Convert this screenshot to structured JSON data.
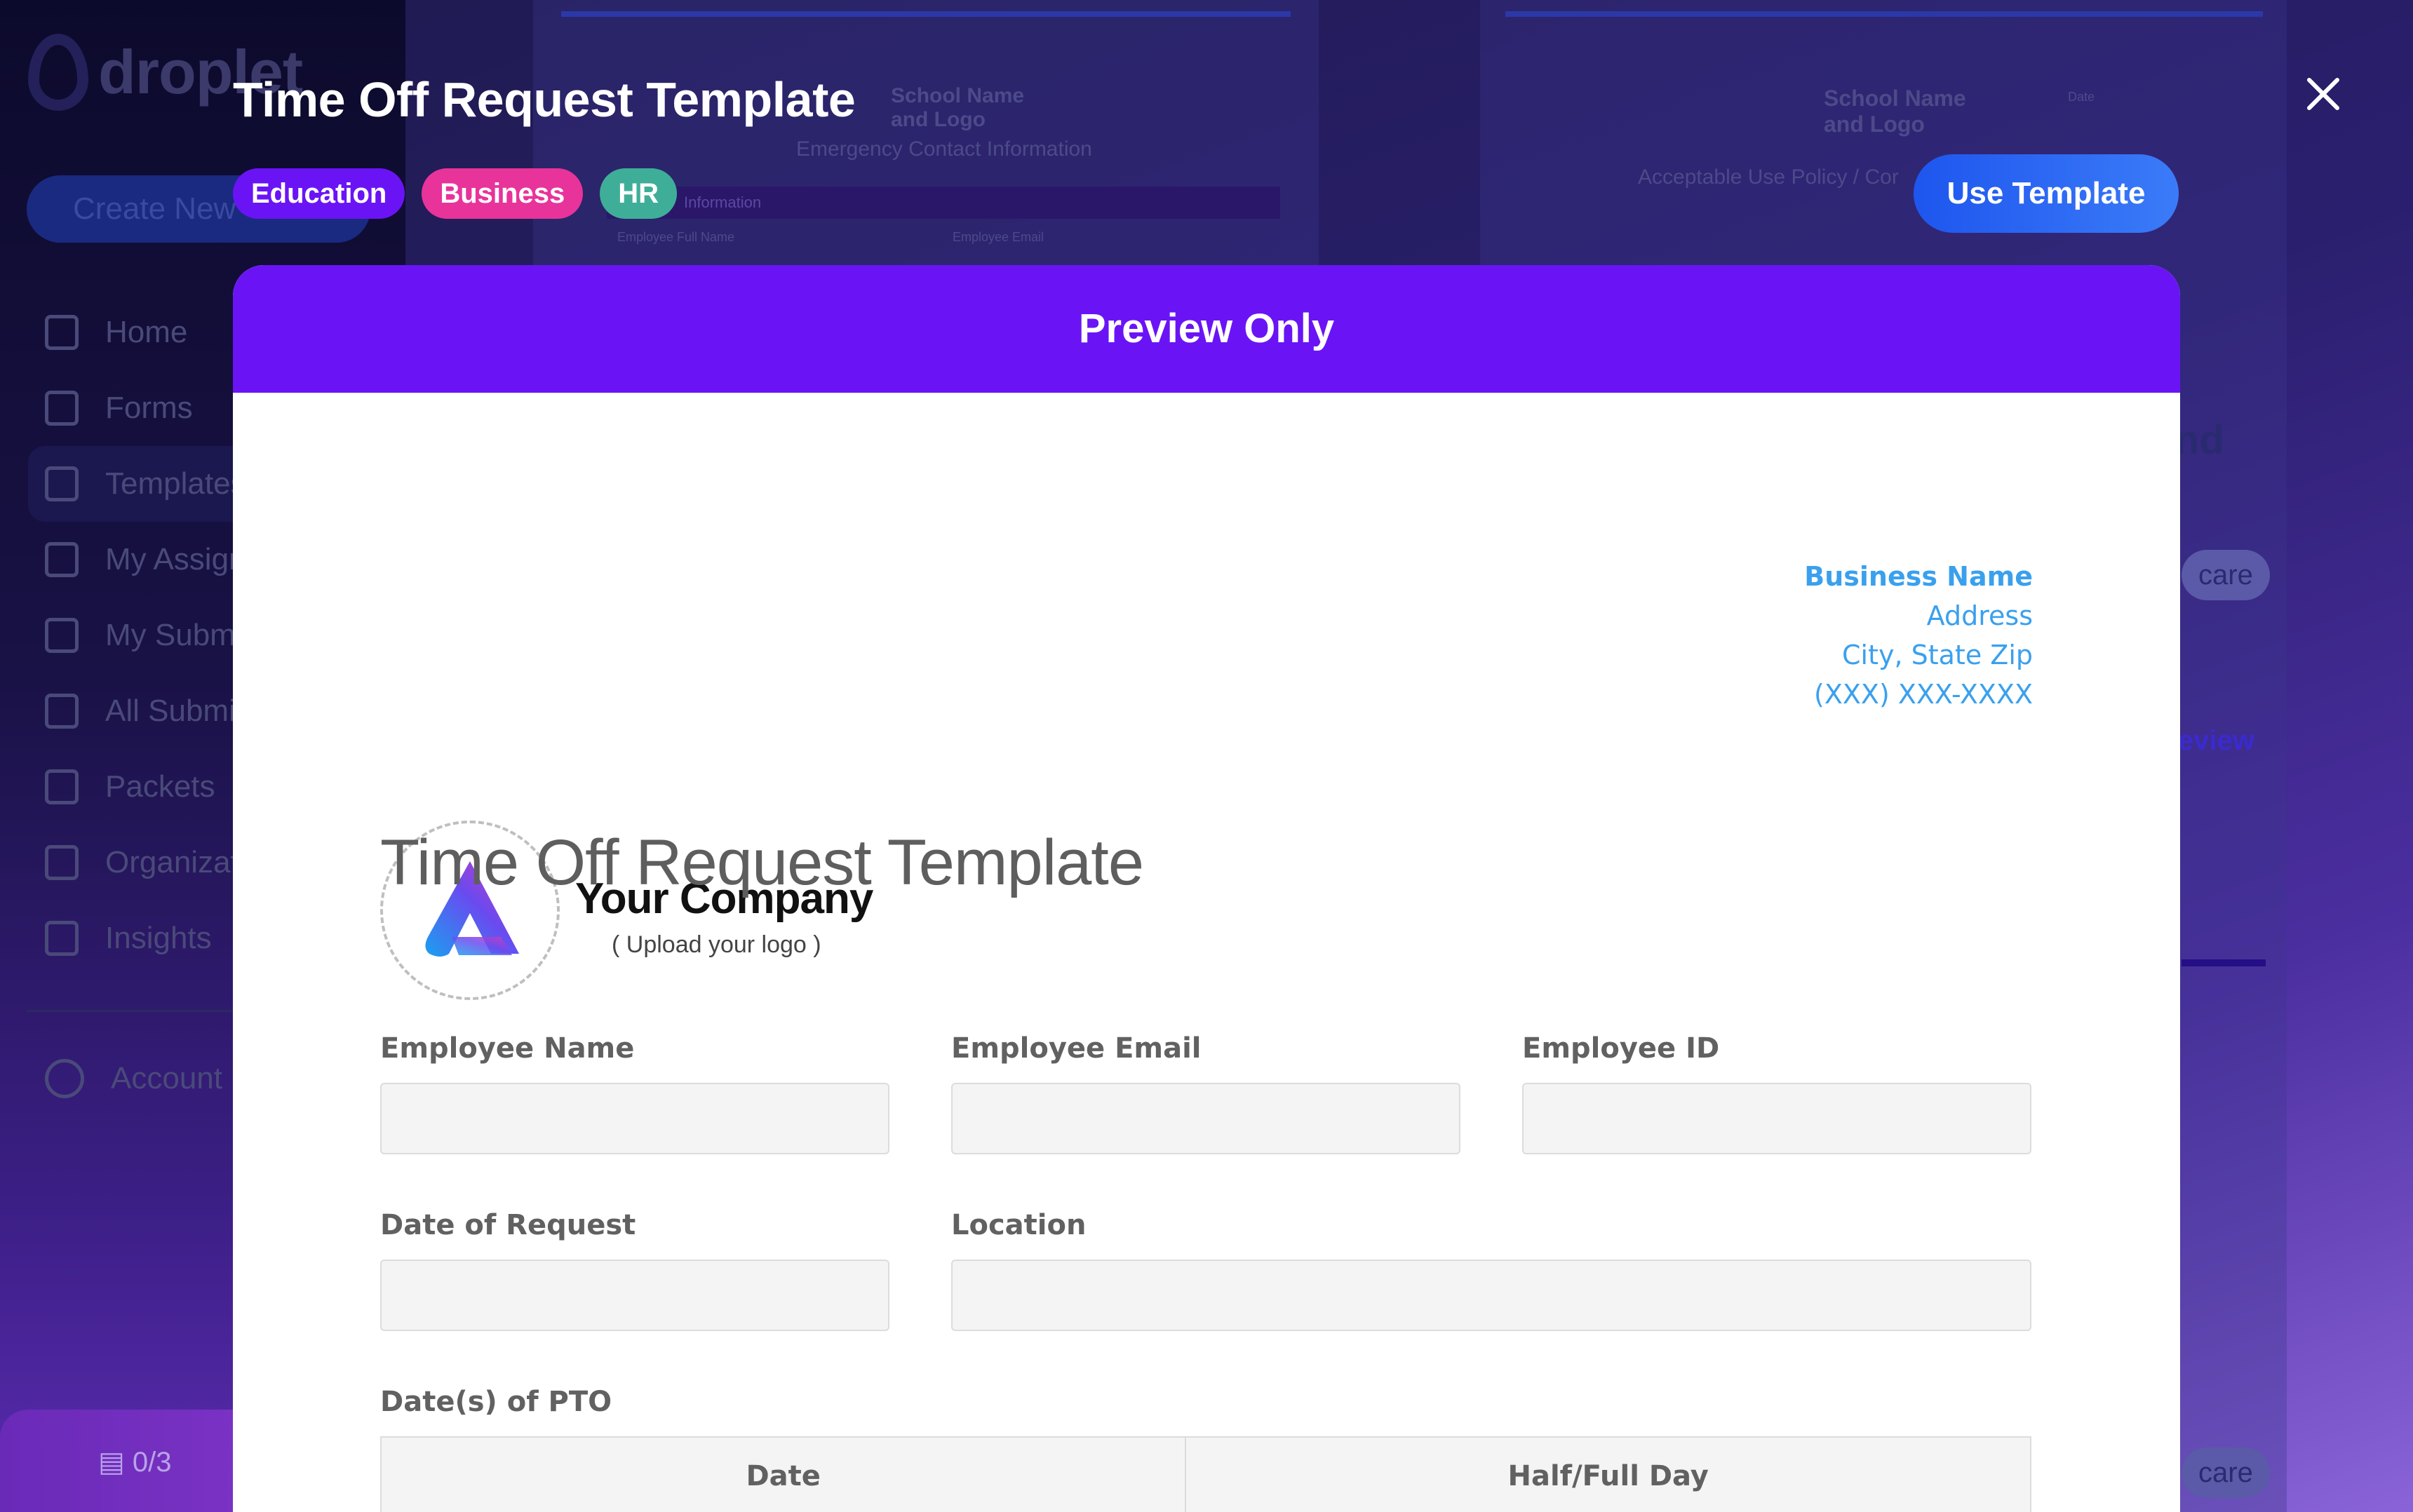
{
  "background": {
    "brand": "droplet",
    "create_button": "Create New",
    "nav": [
      "Home",
      "Forms",
      "Templates",
      "My Assignments",
      "My Submissions",
      "All Submissions",
      "Packets",
      "Organization",
      "Insights"
    ],
    "account": "Account",
    "progress": "0/3",
    "card_left": {
      "school_logo": "School Name and Logo",
      "section": "Emergency Contact Information",
      "table_header": "Information",
      "col1": "Employee Full Name",
      "col2": "Employee Email"
    },
    "card_right": {
      "school_logo": "School Name and Logo",
      "date_label": "Date",
      "policy_title": "Acceptable Use Policy / Cor",
      "partial_heading": "nd",
      "pill_1": "care",
      "preview_link": "eview",
      "pill_2": "care"
    }
  },
  "modal": {
    "title": "Time Off Request Template",
    "tags": [
      {
        "label": "Education",
        "color": "#6a14f5"
      },
      {
        "label": "Business",
        "color": "#e8339b"
      },
      {
        "label": "HR",
        "color": "#3fae98"
      }
    ],
    "use_template_label": "Use Template",
    "banner": "Preview Only"
  },
  "document": {
    "company_name": "Your Company",
    "company_sub": "( Upload your logo )",
    "business": {
      "name": "Business Name",
      "address": "Address",
      "city": "City, State Zip",
      "phone": "(XXX) XXX-XXXX"
    },
    "title": "Time Off Request Template",
    "fields": {
      "employee_name": "Employee Name",
      "employee_email": "Employee Email",
      "employee_id": "Employee ID",
      "date_of_request": "Date of Request",
      "location": "Location",
      "dates_of_pto": "Date(s) of PTO"
    },
    "pto_columns": [
      "Date",
      "Half/Full Day"
    ]
  },
  "colors": {
    "accent_purple": "#6a14f5",
    "button_blue": "#1e56ee",
    "link_blue": "#3aa0ee"
  }
}
